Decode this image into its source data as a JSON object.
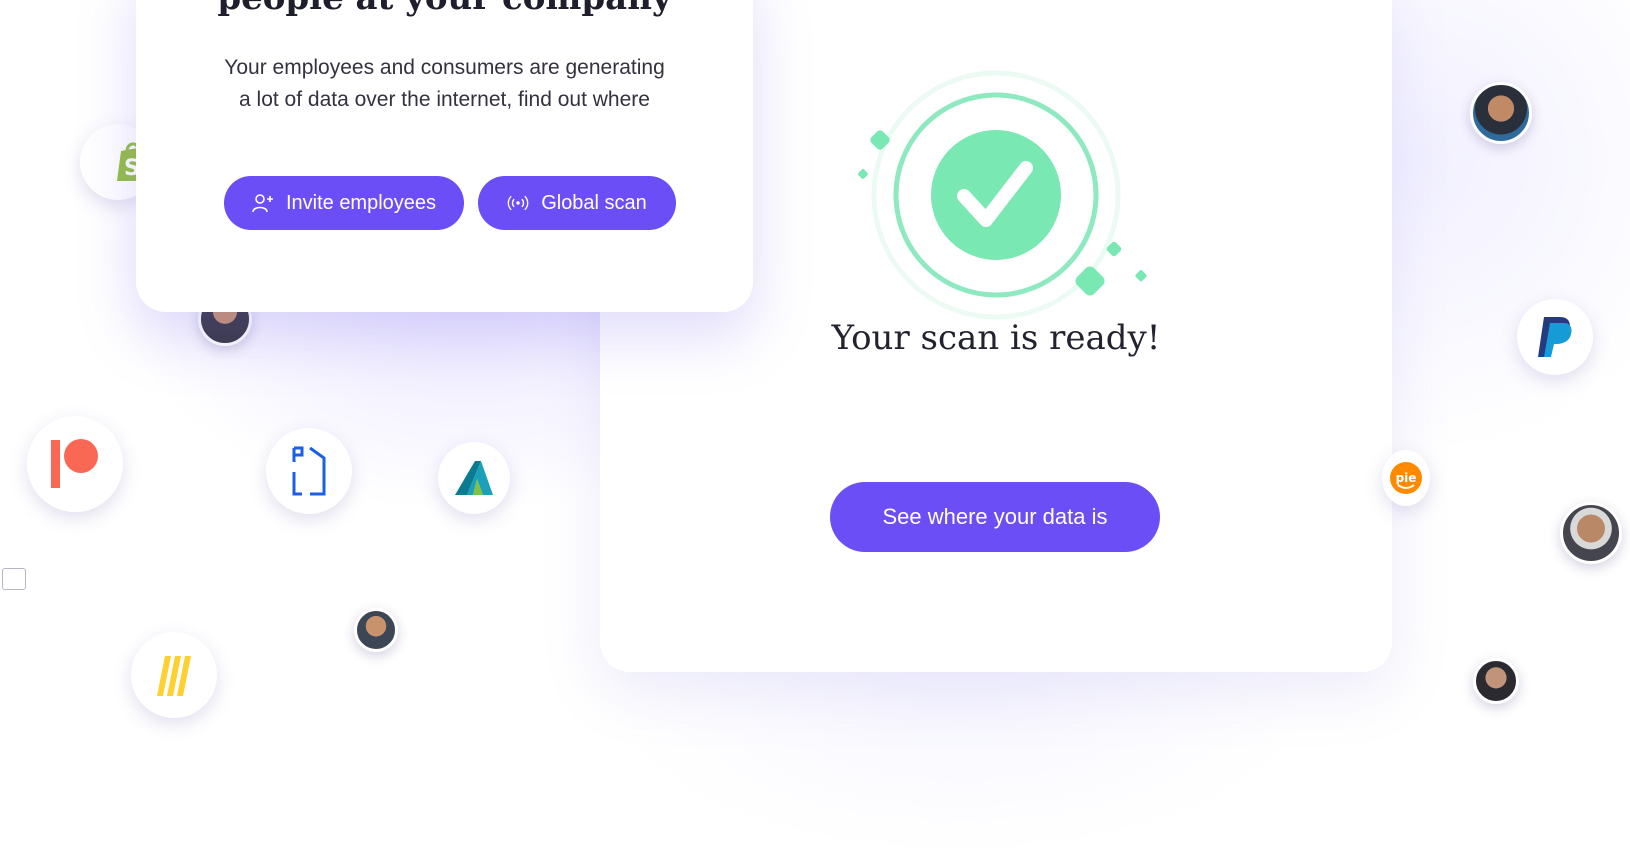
{
  "left_card": {
    "heading": "people at your company",
    "description": "Your employees and consumers are generating a lot of data over the internet, find out where",
    "invite_button_label": "Invite employees",
    "scan_button_label": "Global scan"
  },
  "right_card": {
    "title": "Your scan is ready!",
    "cta_label": "See where your data is"
  },
  "logos": {
    "orange_badge_text": "pie"
  },
  "colors": {
    "accent": "#6b4ef6",
    "success": "#79e8b3",
    "success_ring": "#8ee9c0",
    "heading_text": "#1e1e2c",
    "body_text": "#33333f",
    "shopify": "#95bf47",
    "patreon": "#f96854",
    "paypal_dark": "#253b80",
    "paypal_light": "#179bd7",
    "miro": "#ffd02f",
    "autodesk": "#1aa0b8",
    "orange_badge": "#ff8a00"
  },
  "icons": [
    "person-add-icon",
    "broadcast-icon",
    "check-icon",
    "shopify-logo",
    "patreon-logo",
    "ps-logo",
    "autodesk-logo",
    "miro-logo",
    "paypal-logo",
    "pie-logo"
  ]
}
